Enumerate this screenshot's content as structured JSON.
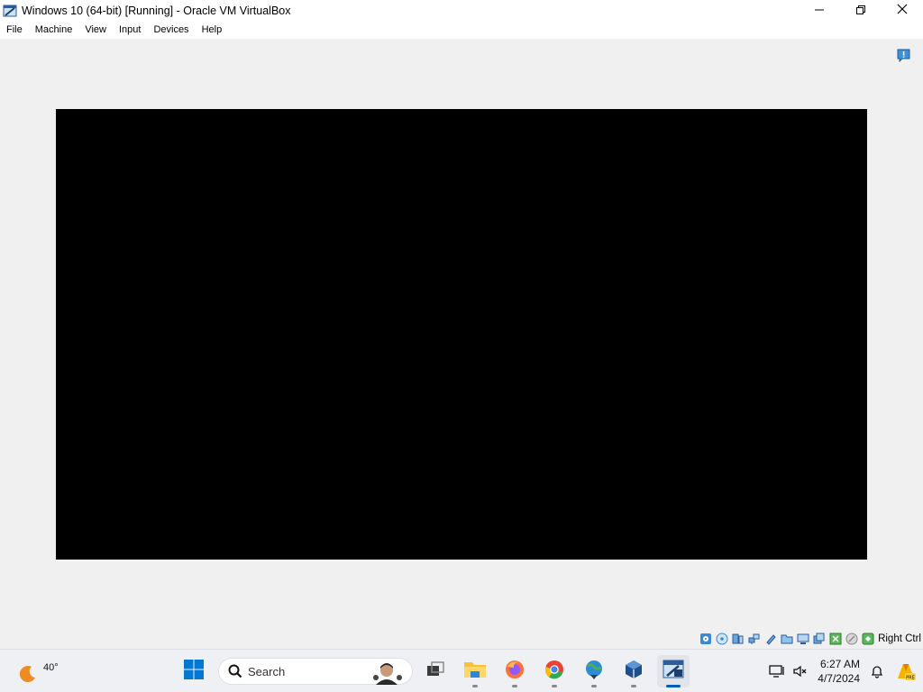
{
  "window": {
    "title": "Windows 10 (64-bit) [Running] - Oracle VM VirtualBox",
    "controls": {
      "minimize": "minimize-icon",
      "maximize": "maximize-icon",
      "close": "close-icon"
    }
  },
  "menu": {
    "items": [
      "File",
      "Machine",
      "View",
      "Input",
      "Devices",
      "Help"
    ]
  },
  "statusbar": {
    "host_key": "Right Ctrl",
    "icons": [
      "hard-disk-icon",
      "optical-drive-icon",
      "audio-icon",
      "network-icon",
      "usb-icon",
      "shared-folders-icon",
      "display-icon",
      "video-capture-icon",
      "cpu-icon",
      "mouse-integration-icon",
      "keyboard-capture-icon"
    ]
  },
  "taskbar": {
    "weather": {
      "temperature": "40°"
    },
    "search": {
      "label": "Search"
    },
    "clock": {
      "time": "6:27 AM",
      "date": "4/7/2024"
    },
    "colors": {
      "accent": "#005fb8",
      "start_blue": "#0078d4",
      "firefox": "#ff7139",
      "chrome_red": "#ea4335",
      "chrome_yellow": "#fbbc05",
      "chrome_green": "#34a853",
      "chrome_blue": "#4285f4"
    }
  }
}
